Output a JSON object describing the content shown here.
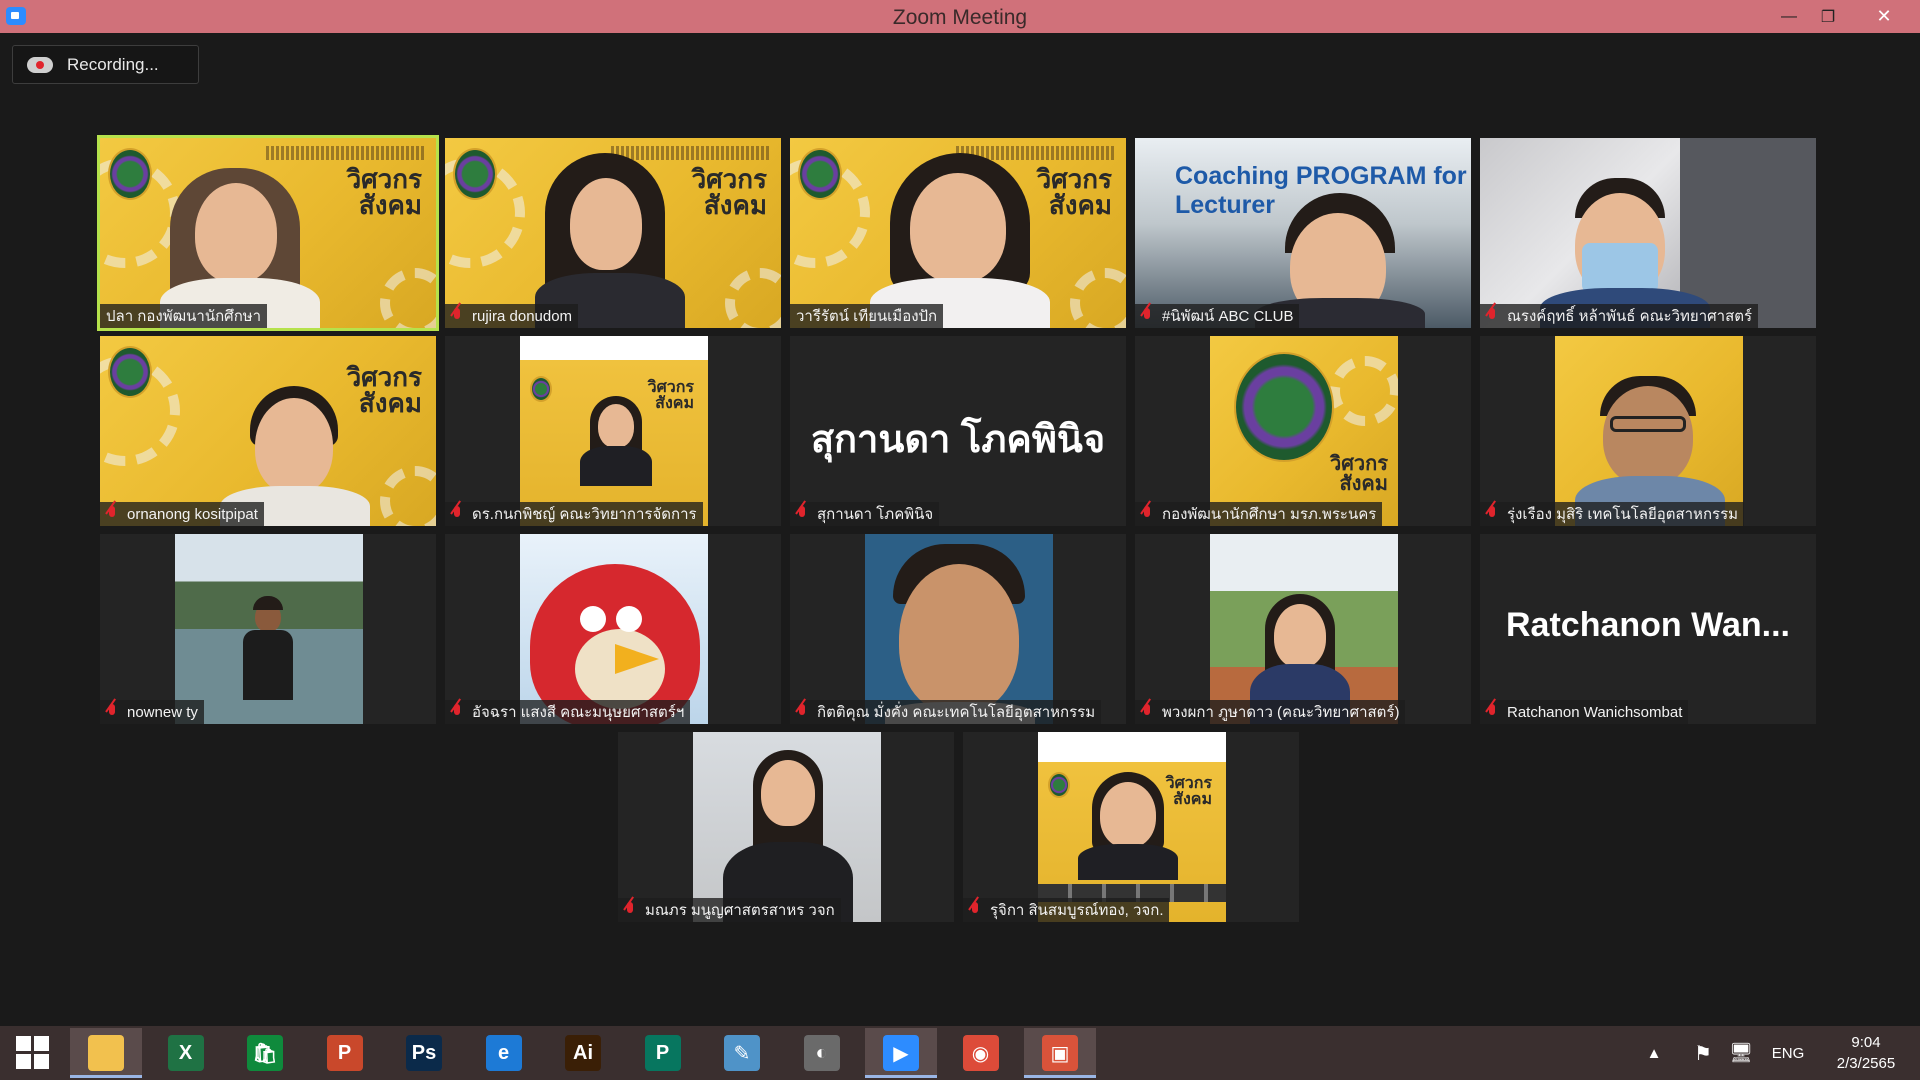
{
  "window": {
    "title": "Zoom Meeting",
    "min_glyph": "—",
    "max_glyph": "❐",
    "close_glyph": "✕"
  },
  "recording": {
    "label": "Recording..."
  },
  "participants": [
    {
      "name": "ปลา กองพัฒนานักศึกษา",
      "muted": false,
      "active": true
    },
    {
      "name": "rujira donudom",
      "muted": true
    },
    {
      "name": "วารีรัตน์ เทียนเมืองปัก",
      "muted": false
    },
    {
      "name": "#นิพัฒน์ ABC CLUB",
      "muted": true,
      "banner": "Coaching PROGRAM for Lecturer"
    },
    {
      "name": "ณรงค์ฤทธิ์ หล้าพันธ์ คณะวิทยาศาสตร์",
      "muted": true
    },
    {
      "name": "ornanong kositpipat",
      "muted": true
    },
    {
      "name": "ดร.กนกพิชญ์ คณะวิทยาการจัดการ",
      "muted": true
    },
    {
      "name": "สุกานดา โภคพินิจ",
      "muted": true,
      "display_name": "สุกานดา โภคพินิจ"
    },
    {
      "name": "กองพัฒนานักศึกษา มรภ.พระนคร",
      "muted": true
    },
    {
      "name": "รุ่งเรือง มุสิริ เทคโนโลยีอุตสาหกรรม",
      "muted": true
    },
    {
      "name": "nownew ty",
      "muted": true
    },
    {
      "name": "อัจฉรา แสงสี คณะมนุษยศาสตร์ฯ",
      "muted": true
    },
    {
      "name": "กิตติคุณ มั่งคั่ง คณะเทคโนโลยีอุตสาหกรรม",
      "muted": true
    },
    {
      "name": "พวงผกา ภูษาดาว (คณะวิทยาศาสตร์)",
      "muted": true
    },
    {
      "name": "Ratchanon Wanichsombat",
      "muted": true,
      "display_name": "Ratchanon  Wan..."
    },
    {
      "name": "มณภร มนูญศาสตรสาหร วจก",
      "muted": true
    },
    {
      "name": "รุจิกา สินสมบูรณ์ทอง, วจก.",
      "muted": true
    }
  ],
  "logo_text": [
    "วิศวกร",
    "สังคม"
  ],
  "taskbar": {
    "apps": [
      {
        "name": "file-explorer",
        "label": "",
        "color": "#f2c14e"
      },
      {
        "name": "excel",
        "label": "X",
        "color": "#1f7244"
      },
      {
        "name": "store",
        "label": "🛍",
        "color": "#0f8a3c"
      },
      {
        "name": "powerpoint",
        "label": "P",
        "color": "#c9482b"
      },
      {
        "name": "photoshop",
        "label": "Ps",
        "color": "#0b2a4a"
      },
      {
        "name": "internet-explorer",
        "label": "e",
        "color": "#1d7ad6"
      },
      {
        "name": "illustrator",
        "label": "Ai",
        "color": "#3a1f06"
      },
      {
        "name": "publisher",
        "label": "P",
        "color": "#07765f"
      },
      {
        "name": "notepad",
        "label": "✎",
        "color": "#4f93c8"
      },
      {
        "name": "photoscape",
        "label": "◐",
        "color": "#6a6a6a"
      },
      {
        "name": "zoom",
        "label": "▶",
        "color": "#2d8cff"
      },
      {
        "name": "chrome",
        "label": "◉",
        "color": "#dd4b39"
      },
      {
        "name": "photos",
        "label": "▣",
        "color": "#d9533a"
      }
    ],
    "tray_expand": "▲",
    "language": "ENG",
    "time": "9:04",
    "date": "2/3/2565"
  }
}
